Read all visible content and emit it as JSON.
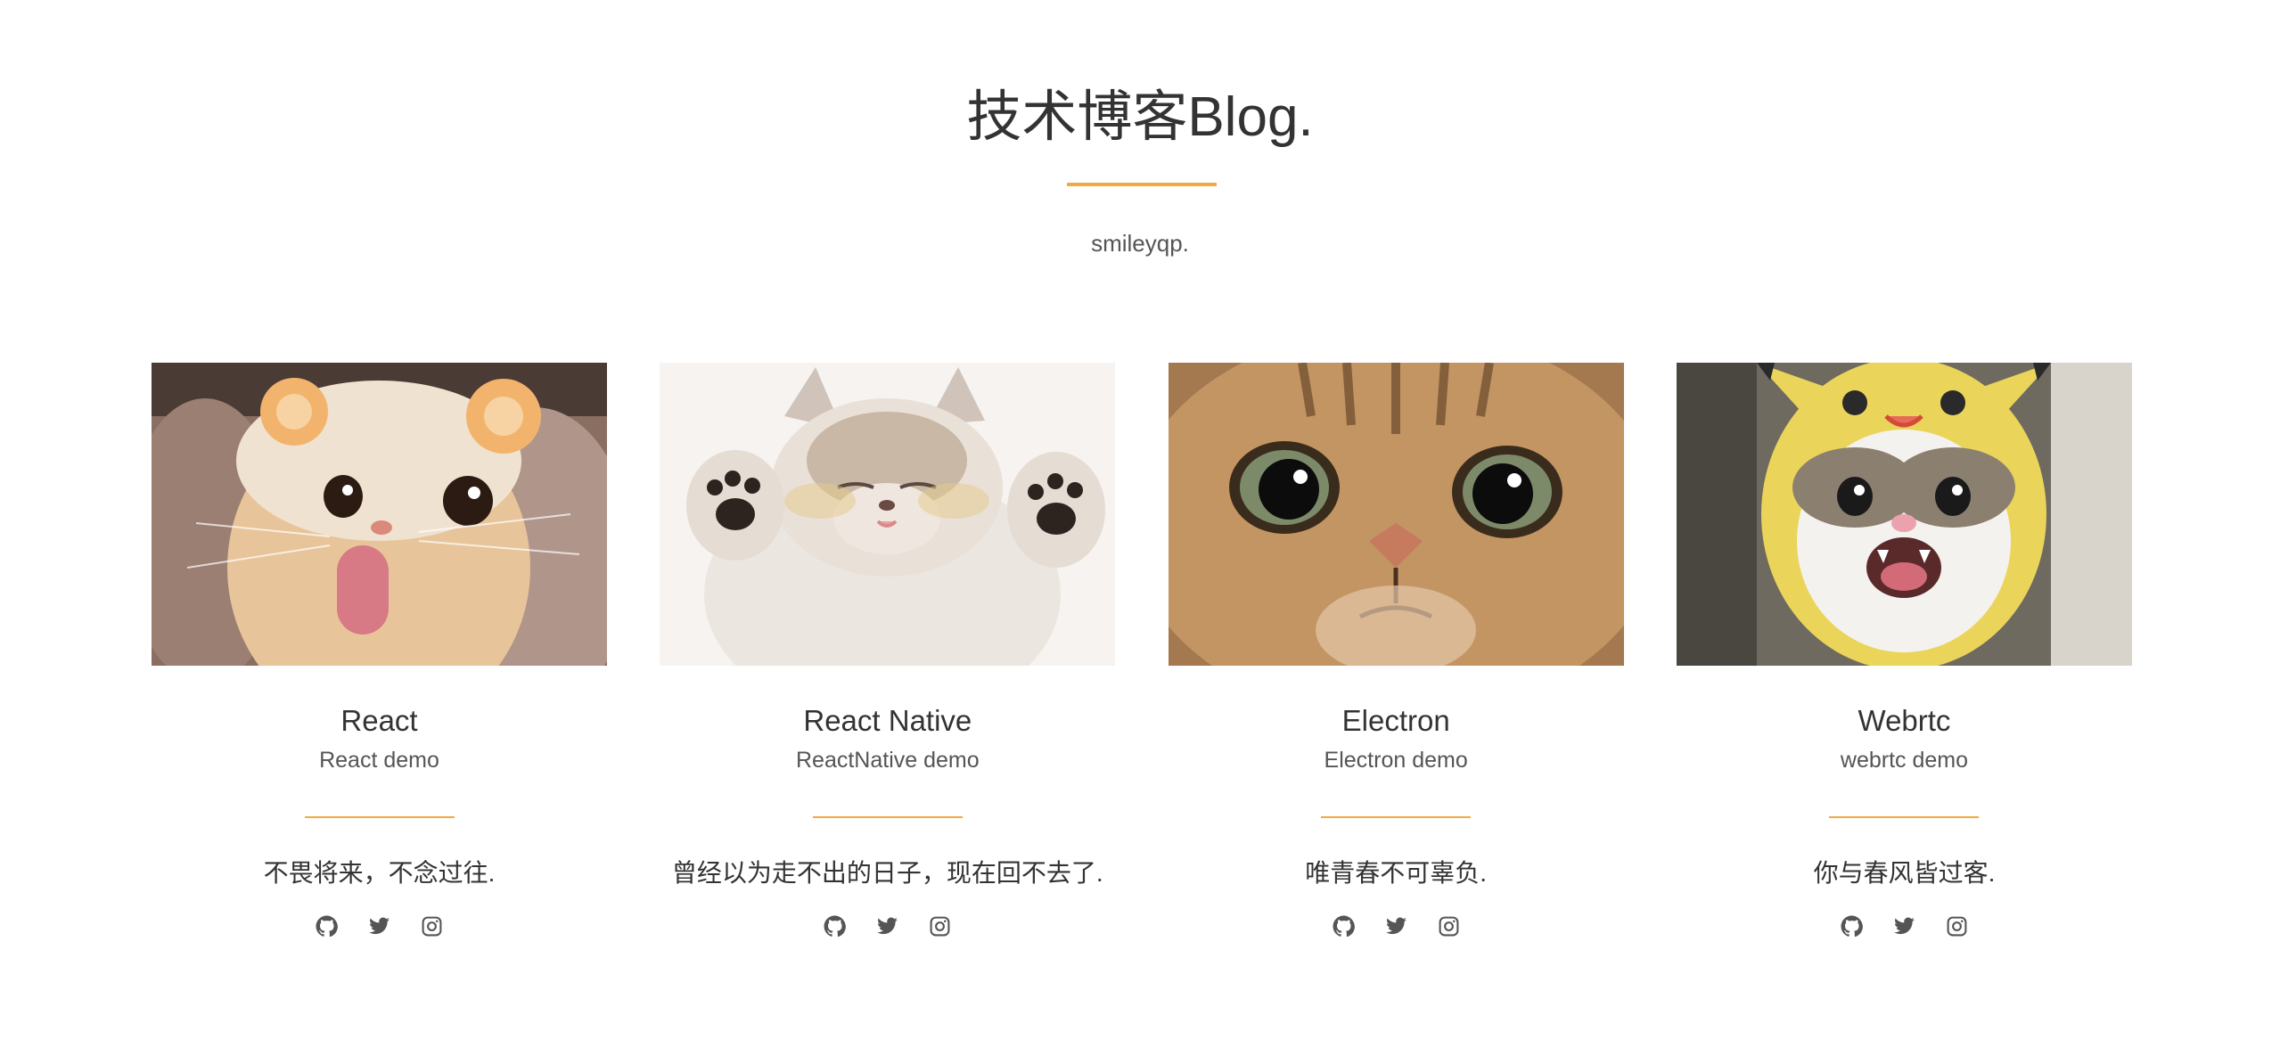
{
  "header": {
    "title": "技术博客Blog.",
    "subtitle": "smileyqp.",
    "accent_color": "#f3a941"
  },
  "cards": [
    {
      "image_icon": "cat-with-hat-photo",
      "title": "React",
      "subtitle": "React demo",
      "quote": "不畏将来，不念过往.",
      "social": [
        "github-icon",
        "twitter-icon",
        "instagram-icon"
      ]
    },
    {
      "image_icon": "kitten-paws-up-photo",
      "title": "React Native",
      "subtitle": "ReactNative demo",
      "quote": "曾经以为走不出的日子，现在回不去了.",
      "social": [
        "github-icon",
        "twitter-icon",
        "instagram-icon"
      ]
    },
    {
      "image_icon": "tabby-cat-closeup-photo",
      "title": "Electron",
      "subtitle": "Electron demo",
      "quote": "唯青春不可辜负.",
      "social": [
        "github-icon",
        "twitter-icon",
        "instagram-icon"
      ]
    },
    {
      "image_icon": "cat-pikachu-hat-photo",
      "title": "Webrtc",
      "subtitle": "webrtc demo",
      "quote": "你与春风皆过客.",
      "social": [
        "github-icon",
        "twitter-icon",
        "instagram-icon"
      ]
    }
  ]
}
